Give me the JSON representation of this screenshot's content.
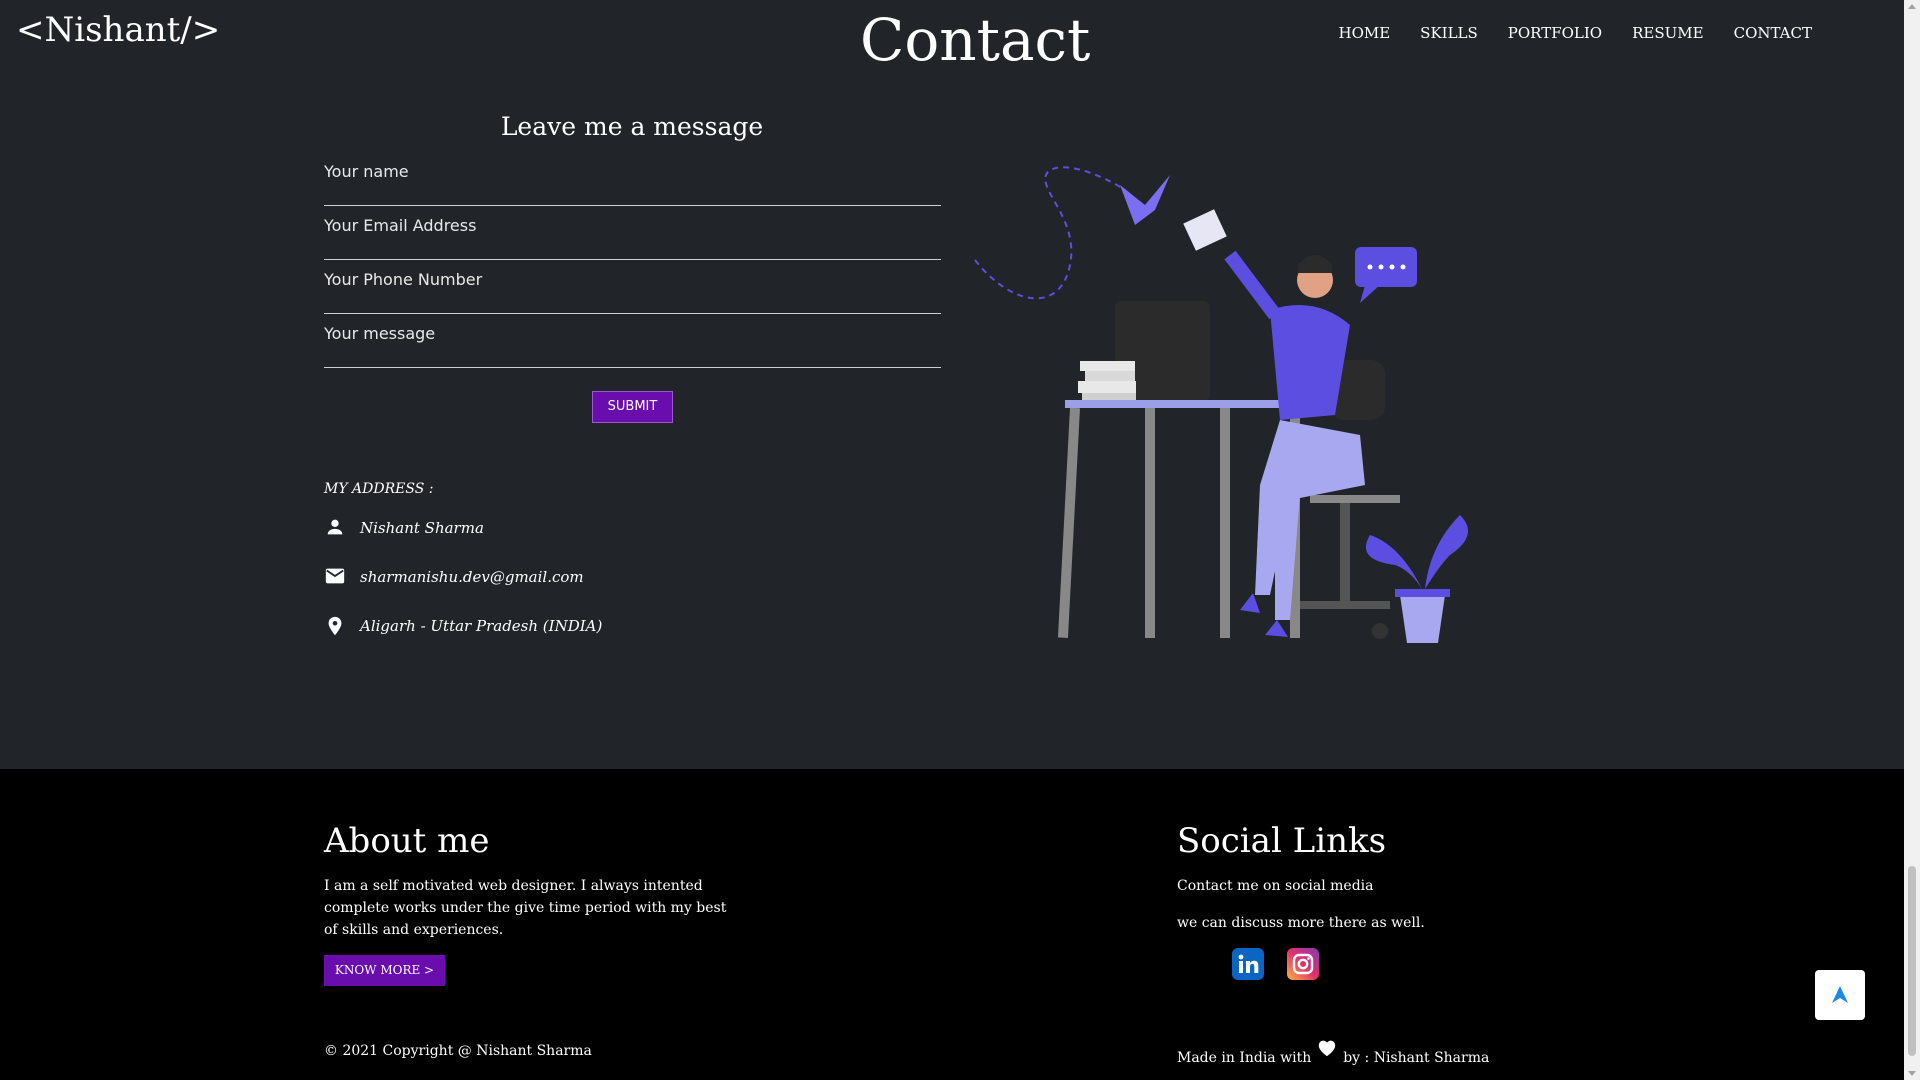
{
  "header": {
    "logo": "<Nishant/>",
    "page_title": "Contact",
    "nav": [
      "HOME",
      "SKILLS",
      "PORTFOLIO",
      "RESUME",
      "CONTACT"
    ]
  },
  "form": {
    "title": "Leave me a message",
    "name_placeholder": "Your name",
    "email_placeholder": "Your Email Address",
    "phone_placeholder": "Your Phone Number",
    "message_placeholder": "Your message",
    "submit_label": "SUBMIT"
  },
  "address": {
    "title": "MY ADDRESS :",
    "name": "Nishant Sharma",
    "email": "sharmanishu.dev@gmail.com",
    "location": "Aligarh - Uttar Pradesh (INDIA)",
    "icons": [
      "person-icon",
      "mail-icon",
      "location-pin-icon"
    ]
  },
  "footer": {
    "about_heading": "About me",
    "about_text": "I am a self motivated web designer. I always intented complete works under the give time period with my best of skills and experiences.",
    "know_more_label": "KNOW MORE >",
    "copyright": "© 2021 Copyright @ Nishant Sharma",
    "social_heading": "Social Links",
    "social_line1": "Contact me on social media",
    "social_line2": "we can discuss more there as well.",
    "made_in_prefix": "Made in India with",
    "made_in_suffix": "by : Nishant Sharma",
    "social_icons": [
      "linkedin-icon",
      "instagram-icon"
    ]
  },
  "colors": {
    "background": "#212529",
    "footer_background": "#000000",
    "accent": "#6a0dad",
    "illustration": "#5b4ee0"
  }
}
